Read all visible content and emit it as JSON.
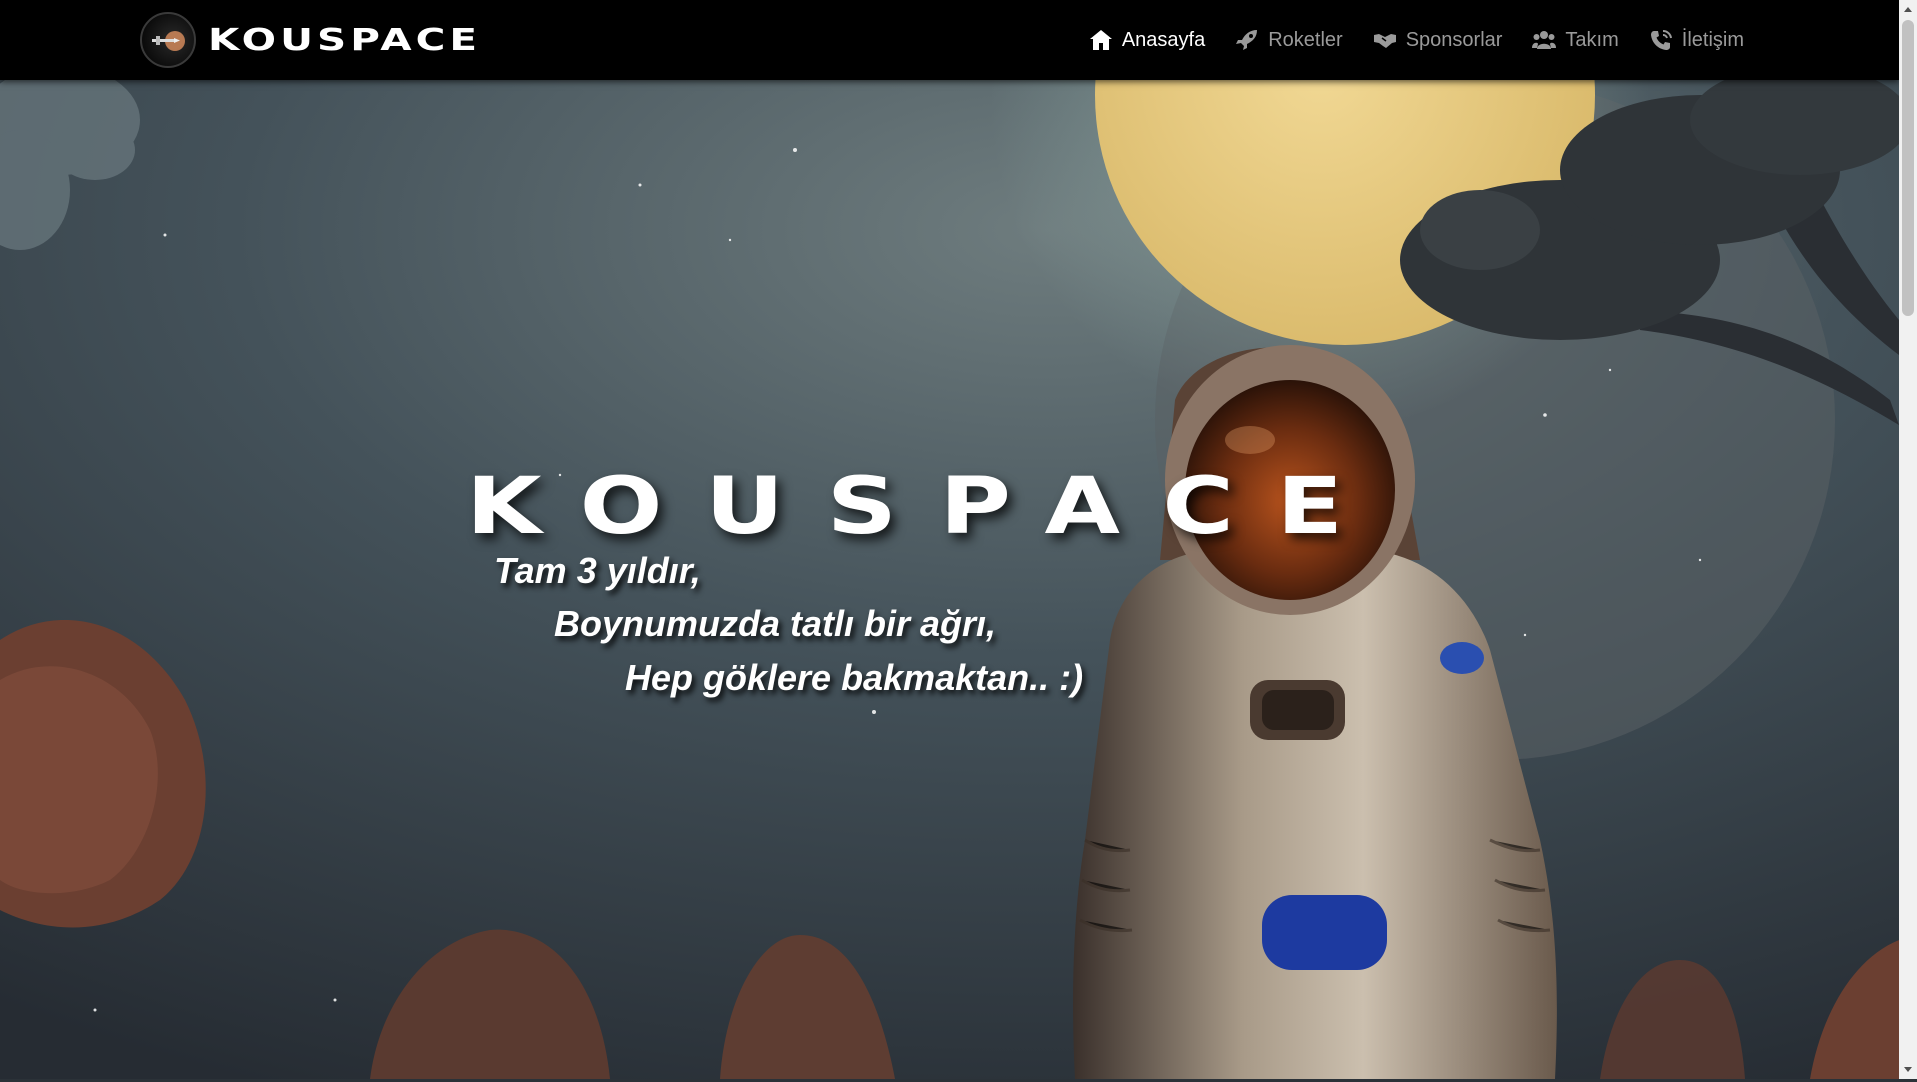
{
  "brand": {
    "name": "KOUSPACE",
    "logo_icon": "rocket-logo-icon"
  },
  "nav": {
    "items": [
      {
        "label": "Anasayfa",
        "icon": "home-icon",
        "active": true
      },
      {
        "label": "Roketler",
        "icon": "rocket-icon",
        "active": false
      },
      {
        "label": "Sponsorlar",
        "icon": "handshake-icon",
        "active": false
      },
      {
        "label": "Takım",
        "icon": "users-icon",
        "active": false
      },
      {
        "label": "İletişim",
        "icon": "phone-icon",
        "active": false
      }
    ]
  },
  "hero": {
    "title": "KOUSPACE",
    "tagline": [
      "Tam 3 yıldır,",
      "Boynumuzda tatlı bir ağrı,",
      "Hep göklere bakmaktan.. :)"
    ]
  },
  "colors": {
    "navbar_bg": "#000000",
    "nav_active": "#ffffff",
    "nav_inactive": "#9a9a9a",
    "moon": "#e8cb7e"
  }
}
